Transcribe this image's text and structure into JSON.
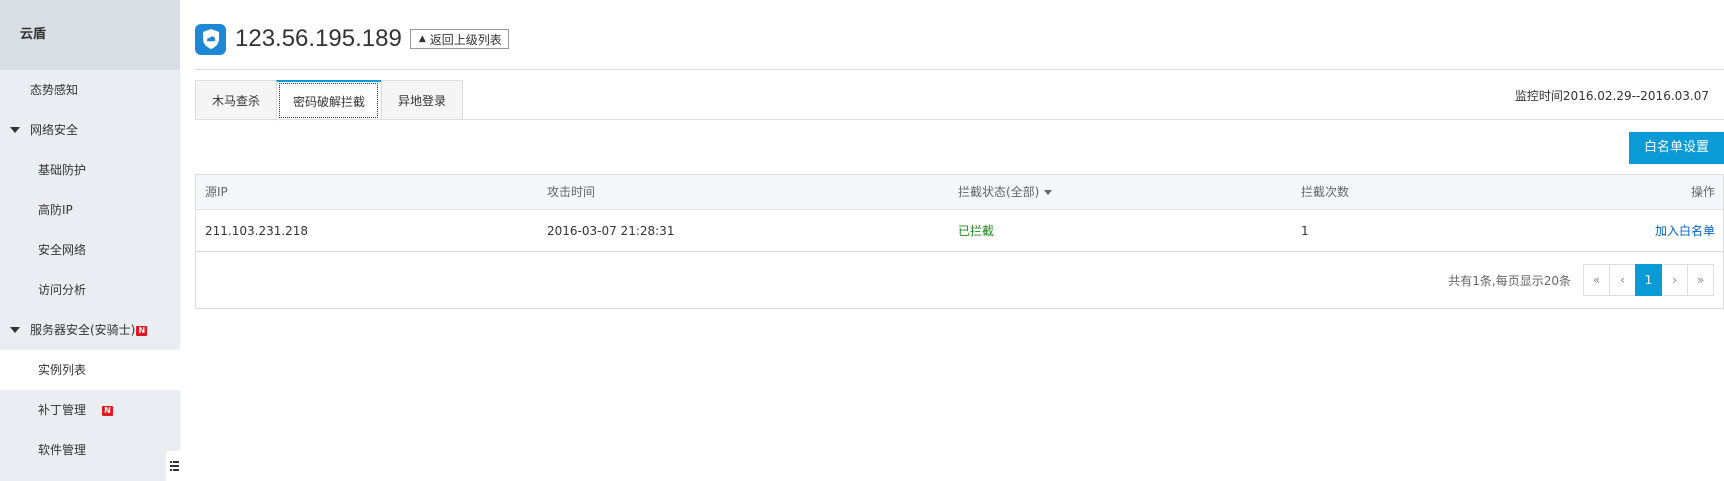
{
  "sidebar": {
    "header": "云盾",
    "items": [
      {
        "label": "态势感知"
      },
      {
        "label": "网络安全"
      },
      {
        "label": "基础防护"
      },
      {
        "label": "高防IP"
      },
      {
        "label": "安全网络"
      },
      {
        "label": "访问分析"
      },
      {
        "label": "服务器安全(安骑士)"
      },
      {
        "label": "实例列表"
      },
      {
        "label": "补丁管理"
      },
      {
        "label": "软件管理"
      }
    ],
    "new_badge": "N"
  },
  "header": {
    "title": "123.56.195.189",
    "back_label": "返回上级列表"
  },
  "tabs": [
    {
      "label": "木马查杀"
    },
    {
      "label": "密码破解拦截"
    },
    {
      "label": "异地登录"
    }
  ],
  "monitor_time": "监控时间2016.02.29--2016.03.07",
  "whitelist_button": "白名单设置",
  "table": {
    "columns": [
      "源IP",
      "攻击时间",
      "拦截状态(全部)",
      "拦截次数",
      "操作"
    ],
    "rows": [
      {
        "source_ip": "211.103.231.218",
        "attack_time": "2016-03-07 21:28:31",
        "status": "已拦截",
        "count": "1",
        "action": "加入白名单"
      }
    ]
  },
  "pagination": {
    "summary": "共有1条,每页显示20条",
    "first": "«",
    "prev": "‹",
    "current": "1",
    "next": "›",
    "last": "»"
  },
  "colors": {
    "accent": "#0a9ad6",
    "status_ok": "#1a8a1a",
    "link": "#0066cc",
    "new_badge": "#e2161f"
  }
}
